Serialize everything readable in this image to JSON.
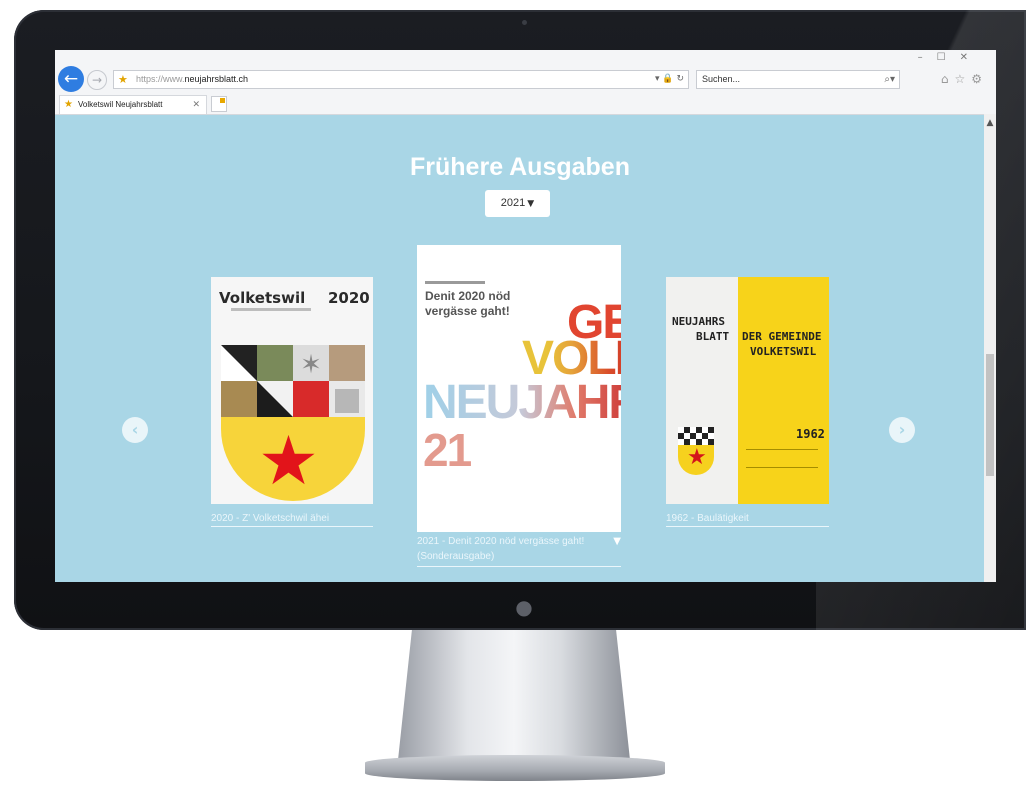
{
  "browser": {
    "url_prefix": "https://www.",
    "url_domain": "neujahrsblatt.ch",
    "search_placeholder": "Suchen...",
    "tab_title": "Volketswil Neujahrsblatt"
  },
  "page": {
    "heading": "Frühere Ausgaben",
    "year_selected": "2021"
  },
  "carousel": {
    "items": [
      {
        "caption": "2020 - Z' Volketschwil ähei",
        "cover_title": "Volketswil",
        "cover_year": "2020"
      },
      {
        "caption": "2021 - Denit 2020 nöd vergässe gaht! (Sonderausgabe)",
        "cover_line1": "Denit 2020 nöd",
        "cover_line2": "vergässe gaht!",
        "cover_word_ge": "GE",
        "cover_word_volk": "VOLK",
        "cover_word_neuj": "NEUJAHR",
        "cover_word_year": "21"
      },
      {
        "caption": "1962 - Baulätigkeit",
        "cover_neu": "NEUJAHRS",
        "cover_blatt": "BLATT",
        "cover_der": "DER GEMEINDE",
        "cover_volk": "VOLKETSWIL",
        "cover_year": "1962"
      }
    ]
  },
  "colors": {
    "page_background": "#a9d6e6",
    "accent_blue": "#2f7de1"
  }
}
